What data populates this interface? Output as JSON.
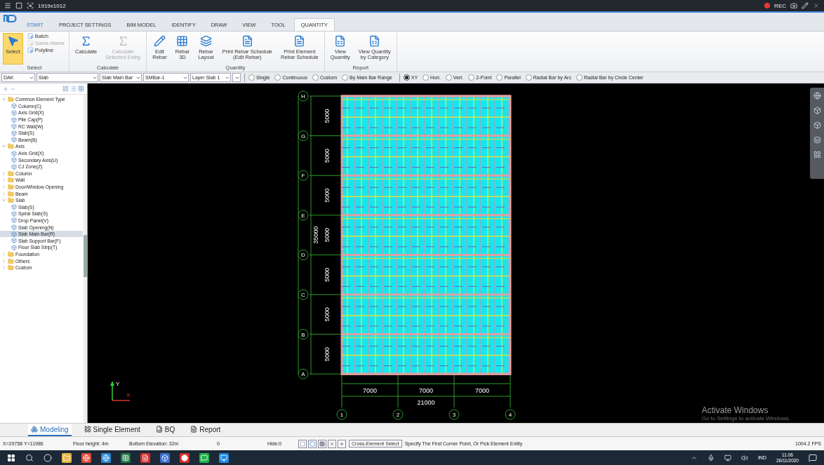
{
  "title_bar": {
    "title": "1919x1012",
    "recording": "REC"
  },
  "tabs": [
    {
      "label": "START",
      "selected": false,
      "highlighted": true
    },
    {
      "label": "PROJECT SETTINGS",
      "selected": false,
      "highlighted": false
    },
    {
      "label": "BIM MODEL",
      "selected": false,
      "highlighted": false
    },
    {
      "label": "IDENTIFY",
      "selected": false,
      "highlighted": false
    },
    {
      "label": "DRAW",
      "selected": false,
      "highlighted": false
    },
    {
      "label": "VIEW",
      "selected": false,
      "highlighted": false
    },
    {
      "label": "TOOL",
      "selected": false,
      "highlighted": false
    },
    {
      "label": "QUANTITY",
      "selected": true,
      "highlighted": false
    }
  ],
  "ribbon": [
    {
      "label": "Select",
      "tools": [
        {
          "kind": "large",
          "label": "Select",
          "selected": true,
          "disabled": false
        },
        {
          "kind": "small",
          "label": "Batch",
          "selected": false,
          "disabled": false
        },
        {
          "kind": "small",
          "label": "Same-Name",
          "selected": false,
          "disabled": true
        },
        {
          "kind": "small",
          "label": "Polyline",
          "selected": false,
          "disabled": false
        }
      ]
    },
    {
      "label": "Calculate",
      "tools": [
        {
          "kind": "large",
          "label": "Calculate",
          "selected": false,
          "disabled": false
        },
        {
          "kind": "large",
          "label": "Calculate\nSelected Entity",
          "selected": false,
          "disabled": true
        }
      ]
    },
    {
      "label": "Quantity",
      "tools": [
        {
          "kind": "large",
          "label": "Edit\nRebar",
          "selected": false,
          "disabled": false
        },
        {
          "kind": "large",
          "label": "Rebar\n3D",
          "selected": false,
          "disabled": false
        },
        {
          "kind": "large",
          "label": "Rebar\nLayout",
          "selected": false,
          "disabled": false
        },
        {
          "kind": "large",
          "label": "Print Rebar Schedule\n(Edit Rebar)",
          "selected": false,
          "disabled": false
        },
        {
          "kind": "large",
          "label": "Print Element\nRebar Schedule",
          "selected": false,
          "disabled": false
        }
      ]
    },
    {
      "label": "Report",
      "tools": [
        {
          "kind": "large",
          "label": "View\nQuantity",
          "selected": false,
          "disabled": false
        },
        {
          "kind": "large",
          "label": "View Quantity\nby Category",
          "selected": false,
          "disabled": false
        }
      ]
    }
  ],
  "option_bar": {
    "dropdowns": [
      {
        "value": "DAK"
      },
      {
        "value": "Slab"
      },
      {
        "value": "Slab Main Bar"
      },
      {
        "value": "SMBar-1"
      },
      {
        "value": "Layer Slab 1"
      }
    ],
    "radio_groups": [
      [
        {
          "label": "Single",
          "selected": false
        },
        {
          "label": "Continuous",
          "selected": false
        },
        {
          "label": "Custom",
          "selected": false
        },
        {
          "label": "By Main Bar Range",
          "selected": false
        }
      ],
      [
        {
          "label": "XY",
          "selected": true
        },
        {
          "label": "Hori.",
          "selected": false
        },
        {
          "label": "Vert.",
          "selected": false
        },
        {
          "label": "2-Point",
          "selected": false
        },
        {
          "label": "Parallel",
          "selected": false
        },
        {
          "label": "Radial Bar by Arc",
          "selected": false
        },
        {
          "label": "Radial Bar by Circle Center",
          "selected": false
        }
      ]
    ]
  },
  "tree": [
    {
      "label": "Common Element Type",
      "expanded": true,
      "children": [
        {
          "label": "Column(C)",
          "selected": false
        },
        {
          "label": "Axis Grid(X)",
          "selected": false
        },
        {
          "label": "Pile Cap(P)",
          "selected": false
        },
        {
          "label": "RC Wall(W)",
          "selected": false
        },
        {
          "label": "Slab(S)",
          "selected": false
        },
        {
          "label": "Beam(B)",
          "selected": false
        }
      ]
    },
    {
      "label": "Axis",
      "expanded": true,
      "children": [
        {
          "label": "Axis Grid(X)",
          "selected": false
        },
        {
          "label": "Secondary Axis(U)",
          "selected": false
        },
        {
          "label": "CJ Zone(Z)",
          "selected": false
        }
      ]
    },
    {
      "label": "Column",
      "expanded": false
    },
    {
      "label": "Wall",
      "expanded": false
    },
    {
      "label": "Door/Window Opening",
      "expanded": false
    },
    {
      "label": "Beam",
      "expanded": false
    },
    {
      "label": "Slab",
      "expanded": true,
      "children": [
        {
          "label": "Slab(S)",
          "selected": false
        },
        {
          "label": "Spiral Slab(S)",
          "selected": false
        },
        {
          "label": "Drop Panel(V)",
          "selected": false
        },
        {
          "label": "Slab Opening(N)",
          "selected": false
        },
        {
          "label": "Slab Main Bar(R)",
          "selected": true
        },
        {
          "label": "Slab Support Bar(F)",
          "selected": false
        },
        {
          "label": "Floor Slab Strip(T)",
          "selected": false
        }
      ]
    },
    {
      "label": "Foundation",
      "expanded": false
    },
    {
      "label": "Others",
      "expanded": false
    },
    {
      "label": "Custom",
      "expanded": false
    }
  ],
  "canvas": {
    "row_axes": [
      "H",
      "G",
      "F",
      "E",
      "D",
      "C",
      "B",
      "A"
    ],
    "row_dims": [
      "5000",
      "5000",
      "5000",
      "5000",
      "5000",
      "5000",
      "5000"
    ],
    "total_row_dim": "35000",
    "col_axes": [
      "1",
      "2",
      "3",
      "4"
    ],
    "col_dims": [
      "7000",
      "7000",
      "7000"
    ],
    "total_col_dim": "21000",
    "ucs": {
      "y": "Y",
      "x": "X"
    },
    "notice": {
      "title": "Activate Windows",
      "subtitle": "Go to Settings to activate Windows."
    }
  },
  "bottom_tabs": [
    {
      "label": "Modeling",
      "selected": true
    },
    {
      "label": "Single Element",
      "selected": false
    },
    {
      "label": "BQ",
      "selected": false
    },
    {
      "label": "Report",
      "selected": false
    }
  ],
  "status_bar": {
    "coords": "X=29758 Y=11986",
    "floor_height": "Floor height: 4m",
    "bottom_elevation": "Bottom Elevation: 32m",
    "value": "0",
    "hide": "Hide:0",
    "select_mode": "Cross-Element Select",
    "prompt": "Specify The First Corner Point, Or Pick Element Entity",
    "fps": "1004.2 FPS"
  },
  "taskbar": {
    "language": "IND",
    "time": "11.06",
    "date": "26/11/2020"
  }
}
